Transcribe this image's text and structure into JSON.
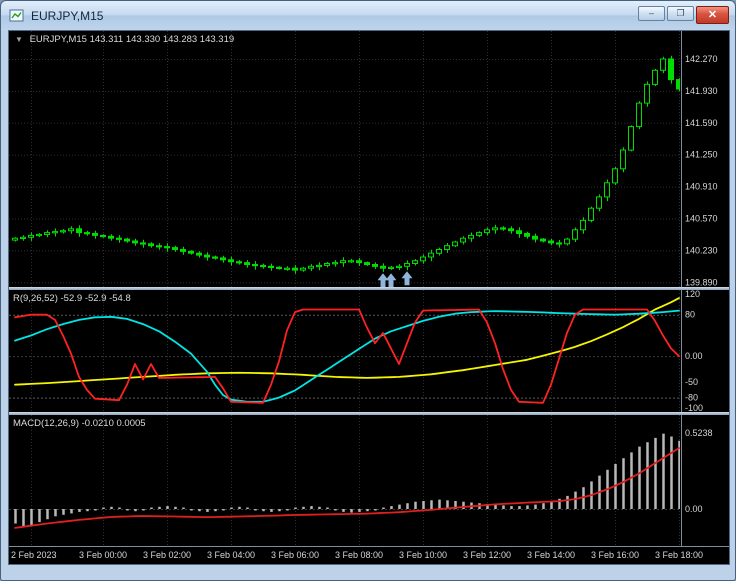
{
  "window": {
    "title": "EURJPY,M15",
    "buttons": {
      "minimize": "–",
      "maximize": "❐",
      "close": "✕"
    }
  },
  "panels": {
    "main_header": {
      "collapse_glyph": "▼",
      "text": "EURJPY,M15  143.311 143.330 143.283 143.319"
    },
    "oscillator_header": "R(9,26,52) -52.9 -52.9 -54.8",
    "macd_header": "MACD(12,26,9) -0.0210 0.0005"
  },
  "chart_data": {
    "type": "candlestick",
    "symbol": "EURJPY",
    "timeframe": "M15",
    "colors": {
      "background": "#000000",
      "grid": "#2e2e2e",
      "bull": "#00dd00",
      "axis_text": "#d6d6d6",
      "marker": "#8fb6da",
      "oscillator": {
        "fast": "#ff2222",
        "mid": "#00e5e5",
        "slow": "#f5f500"
      },
      "macd_histogram": "#b8b8b8",
      "macd_signal": "#e01f1f"
    },
    "price_axis_labels": [
      "142.270",
      "141.930",
      "141.590",
      "141.250",
      "140.910",
      "140.570",
      "140.230",
      "139.890"
    ],
    "time_ticks": [
      {
        "i": 2,
        "label": "2 Feb 2023"
      },
      {
        "i": 11,
        "label": "3 Feb 00:00"
      },
      {
        "i": 19,
        "label": "3 Feb 02:00"
      },
      {
        "i": 27,
        "label": "3 Feb 04:00"
      },
      {
        "i": 35,
        "label": "3 Feb 06:00"
      },
      {
        "i": 43,
        "label": "3 Feb 08:00"
      },
      {
        "i": 51,
        "label": "3 Feb 10:00"
      },
      {
        "i": 59,
        "label": "3 Feb 12:00"
      },
      {
        "i": 67,
        "label": "3 Feb 14:00"
      },
      {
        "i": 75,
        "label": "3 Feb 16:00"
      },
      {
        "i": 83,
        "label": "3 Feb 18:00"
      }
    ],
    "closes": [
      140.36,
      140.37,
      140.39,
      140.4,
      140.42,
      140.43,
      140.44,
      140.46,
      140.42,
      140.41,
      140.39,
      140.38,
      140.36,
      140.35,
      140.33,
      140.31,
      140.3,
      140.28,
      140.27,
      140.26,
      140.24,
      140.22,
      140.2,
      140.18,
      140.16,
      140.15,
      140.13,
      140.11,
      140.1,
      140.08,
      140.07,
      140.06,
      140.05,
      140.04,
      140.04,
      140.02,
      140.04,
      140.06,
      140.07,
      140.09,
      140.1,
      140.12,
      140.12,
      140.1,
      140.08,
      140.06,
      140.04,
      140.05,
      140.06,
      140.09,
      140.12,
      140.16,
      140.2,
      140.24,
      140.28,
      140.32,
      140.36,
      140.39,
      140.42,
      140.45,
      140.47,
      140.46,
      140.44,
      140.41,
      140.38,
      140.35,
      140.33,
      140.31,
      140.3,
      140.35,
      140.45,
      140.55,
      140.68,
      140.8,
      140.95,
      141.1,
      141.3,
      141.55,
      141.8,
      142.0,
      142.15,
      142.27,
      142.05,
      141.95
    ],
    "markers": [
      {
        "i": 46,
        "glyph": "up-arrow"
      },
      {
        "i": 47,
        "glyph": "up-arrow"
      },
      {
        "i": 49,
        "glyph": "up-arrow"
      }
    ],
    "oscillator": {
      "name": "R(9,26,52)",
      "range": [
        -100,
        120
      ],
      "levels": [
        80,
        0,
        -80
      ],
      "axis_labels": [
        {
          "v": 120,
          "t": "120"
        },
        {
          "v": 80,
          "t": "80"
        },
        {
          "v": 0,
          "t": "0.00"
        },
        {
          "v": -50,
          "t": "-50"
        },
        {
          "v": -80,
          "t": "-80"
        },
        {
          "v": -100,
          "t": "-100"
        }
      ],
      "series": {
        "fast_red": [
          [
            0,
            75
          ],
          [
            2,
            80
          ],
          [
            4,
            80
          ],
          [
            5,
            70
          ],
          [
            6,
            40
          ],
          [
            7,
            5
          ],
          [
            8,
            -40
          ],
          [
            9,
            -65
          ],
          [
            10,
            -82
          ],
          [
            13,
            -85
          ],
          [
            14,
            -55
          ],
          [
            15,
            -15
          ],
          [
            16,
            -45
          ],
          [
            17,
            -15
          ],
          [
            18,
            -42
          ],
          [
            25,
            -40
          ],
          [
            26,
            -62
          ],
          [
            27,
            -88
          ],
          [
            31,
            -90
          ],
          [
            32,
            -55
          ],
          [
            33,
            -10
          ],
          [
            34,
            50
          ],
          [
            35,
            85
          ],
          [
            36,
            90
          ],
          [
            43,
            90
          ],
          [
            44,
            55
          ],
          [
            45,
            25
          ],
          [
            46,
            45
          ],
          [
            47,
            15
          ],
          [
            48,
            -15
          ],
          [
            49,
            25
          ],
          [
            50,
            65
          ],
          [
            51,
            88
          ],
          [
            58,
            90
          ],
          [
            59,
            65
          ],
          [
            60,
            25
          ],
          [
            61,
            -25
          ],
          [
            62,
            -65
          ],
          [
            63,
            -88
          ],
          [
            66,
            -90
          ],
          [
            67,
            -55
          ],
          [
            68,
            -5
          ],
          [
            69,
            45
          ],
          [
            70,
            80
          ],
          [
            71,
            90
          ],
          [
            79,
            90
          ],
          [
            80,
            68
          ],
          [
            81,
            40
          ],
          [
            82,
            15
          ],
          [
            83,
            0
          ]
        ],
        "mid_cyan": [
          [
            0,
            30
          ],
          [
            2,
            40
          ],
          [
            4,
            52
          ],
          [
            6,
            62
          ],
          [
            8,
            70
          ],
          [
            10,
            75
          ],
          [
            12,
            76
          ],
          [
            14,
            72
          ],
          [
            16,
            62
          ],
          [
            18,
            48
          ],
          [
            20,
            28
          ],
          [
            22,
            5
          ],
          [
            24,
            -30
          ],
          [
            25,
            -55
          ],
          [
            26,
            -75
          ],
          [
            27,
            -84
          ],
          [
            29,
            -88
          ],
          [
            31,
            -88
          ],
          [
            33,
            -80
          ],
          [
            35,
            -66
          ],
          [
            37,
            -46
          ],
          [
            39,
            -26
          ],
          [
            41,
            -6
          ],
          [
            43,
            14
          ],
          [
            45,
            34
          ],
          [
            47,
            48
          ],
          [
            49,
            58
          ],
          [
            51,
            68
          ],
          [
            53,
            76
          ],
          [
            55,
            82
          ],
          [
            57,
            85
          ],
          [
            60,
            87
          ],
          [
            65,
            85
          ],
          [
            70,
            82
          ],
          [
            75,
            80
          ],
          [
            78,
            82
          ],
          [
            81,
            85
          ],
          [
            83,
            88
          ]
        ],
        "slow_yellow": [
          [
            0,
            -55
          ],
          [
            4,
            -52
          ],
          [
            8,
            -48
          ],
          [
            12,
            -44
          ],
          [
            16,
            -40
          ],
          [
            20,
            -36
          ],
          [
            24,
            -33
          ],
          [
            28,
            -32
          ],
          [
            32,
            -33
          ],
          [
            36,
            -36
          ],
          [
            40,
            -40
          ],
          [
            44,
            -42
          ],
          [
            48,
            -40
          ],
          [
            52,
            -35
          ],
          [
            56,
            -27
          ],
          [
            60,
            -17
          ],
          [
            64,
            -7
          ],
          [
            66,
            1
          ],
          [
            68,
            9
          ],
          [
            70,
            18
          ],
          [
            72,
            29
          ],
          [
            74,
            42
          ],
          [
            76,
            56
          ],
          [
            78,
            72
          ],
          [
            80,
            90
          ],
          [
            82,
            104
          ],
          [
            83,
            112
          ]
        ]
      }
    },
    "macd": {
      "axis_labels": [
        {
          "v": 0.5238,
          "t": "0.5238"
        },
        {
          "v": 0,
          "t": "0.00"
        }
      ],
      "histogram": [
        -0.1,
        -0.12,
        -0.11,
        -0.09,
        -0.07,
        -0.05,
        -0.04,
        -0.03,
        -0.02,
        -0.015,
        -0.01,
        0.01,
        0.015,
        0.01,
        -0.01,
        -0.015,
        -0.01,
        0.01,
        0.015,
        0.02,
        0.015,
        0.01,
        -0.01,
        -0.015,
        -0.02,
        -0.015,
        -0.01,
        0.01,
        0.015,
        0.01,
        -0.01,
        -0.015,
        -0.02,
        -0.015,
        -0.01,
        0.01,
        0.015,
        0.02,
        0.015,
        0.01,
        -0.01,
        -0.02,
        -0.025,
        -0.02,
        -0.015,
        -0.01,
        0.01,
        0.02,
        0.03,
        0.04,
        0.05,
        0.055,
        0.06,
        0.065,
        0.06,
        0.055,
        0.05,
        0.045,
        0.04,
        0.035,
        0.03,
        0.025,
        0.02,
        0.02,
        0.025,
        0.03,
        0.04,
        0.05,
        0.07,
        0.09,
        0.12,
        0.15,
        0.19,
        0.23,
        0.27,
        0.31,
        0.35,
        0.39,
        0.43,
        0.46,
        0.49,
        0.52,
        0.5,
        0.47
      ],
      "signal": [
        [
          0,
          -0.13
        ],
        [
          4,
          -0.1
        ],
        [
          8,
          -0.075
        ],
        [
          12,
          -0.055
        ],
        [
          16,
          -0.048
        ],
        [
          20,
          -0.052
        ],
        [
          24,
          -0.056
        ],
        [
          28,
          -0.052
        ],
        [
          32,
          -0.046
        ],
        [
          36,
          -0.04
        ],
        [
          40,
          -0.036
        ],
        [
          44,
          -0.032
        ],
        [
          48,
          -0.022
        ],
        [
          52,
          -0.006
        ],
        [
          56,
          0.014
        ],
        [
          60,
          0.032
        ],
        [
          64,
          0.044
        ],
        [
          68,
          0.054
        ],
        [
          70,
          0.068
        ],
        [
          72,
          0.095
        ],
        [
          74,
          0.135
        ],
        [
          76,
          0.185
        ],
        [
          78,
          0.245
        ],
        [
          80,
          0.315
        ],
        [
          82,
          0.385
        ],
        [
          83,
          0.42
        ]
      ]
    }
  }
}
